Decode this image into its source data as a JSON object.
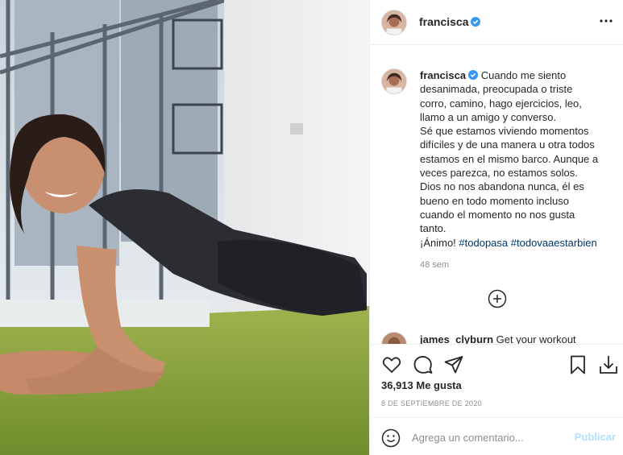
{
  "post": {
    "username": "francisca",
    "verified": true,
    "caption_lines": [
      "Cuando me siento",
      "desanimada, preocupada o triste",
      "corro, camino, hago ejercicios, leo,",
      "llamo a un amigo y converso.",
      "Sé que estamos viviendo momentos",
      "difíciles y de una manera u otra todos",
      "estamos en el mismo barco. Aunque a",
      "veces parezca, no estamos solos.",
      "Dios no nos abandona nunca, él es",
      "bueno en todo momento incluso",
      "cuando el momento no nos gusta",
      "tanto."
    ],
    "caption_last_line": "¡Ánimo!",
    "hashtags": [
      "#todopasa",
      "#todovaaestarbien"
    ],
    "time_ago": "48 sem",
    "likes_count": "36,913",
    "likes_label": "Me gusta",
    "date": "8 DE SEPTIEMBRE DE 2020"
  },
  "next_comment": {
    "username": "james_clyburn",
    "text": "Get your workout"
  },
  "add_comment": {
    "placeholder": "Agrega un comentario...",
    "post_label": "Publicar"
  },
  "icons": {
    "header_more": "more-horizontal-icon",
    "load_more": "plus-circle-icon",
    "actions": [
      "heart-icon",
      "comment-icon",
      "share-icon",
      "bookmark-icon",
      "download-icon"
    ],
    "emoji": "emoji-icon"
  },
  "colors": {
    "verified": "#3897f0",
    "hashtag": "#00376b",
    "publish_disabled": "#b2dffc",
    "muted_text": "#8e8e8e"
  }
}
